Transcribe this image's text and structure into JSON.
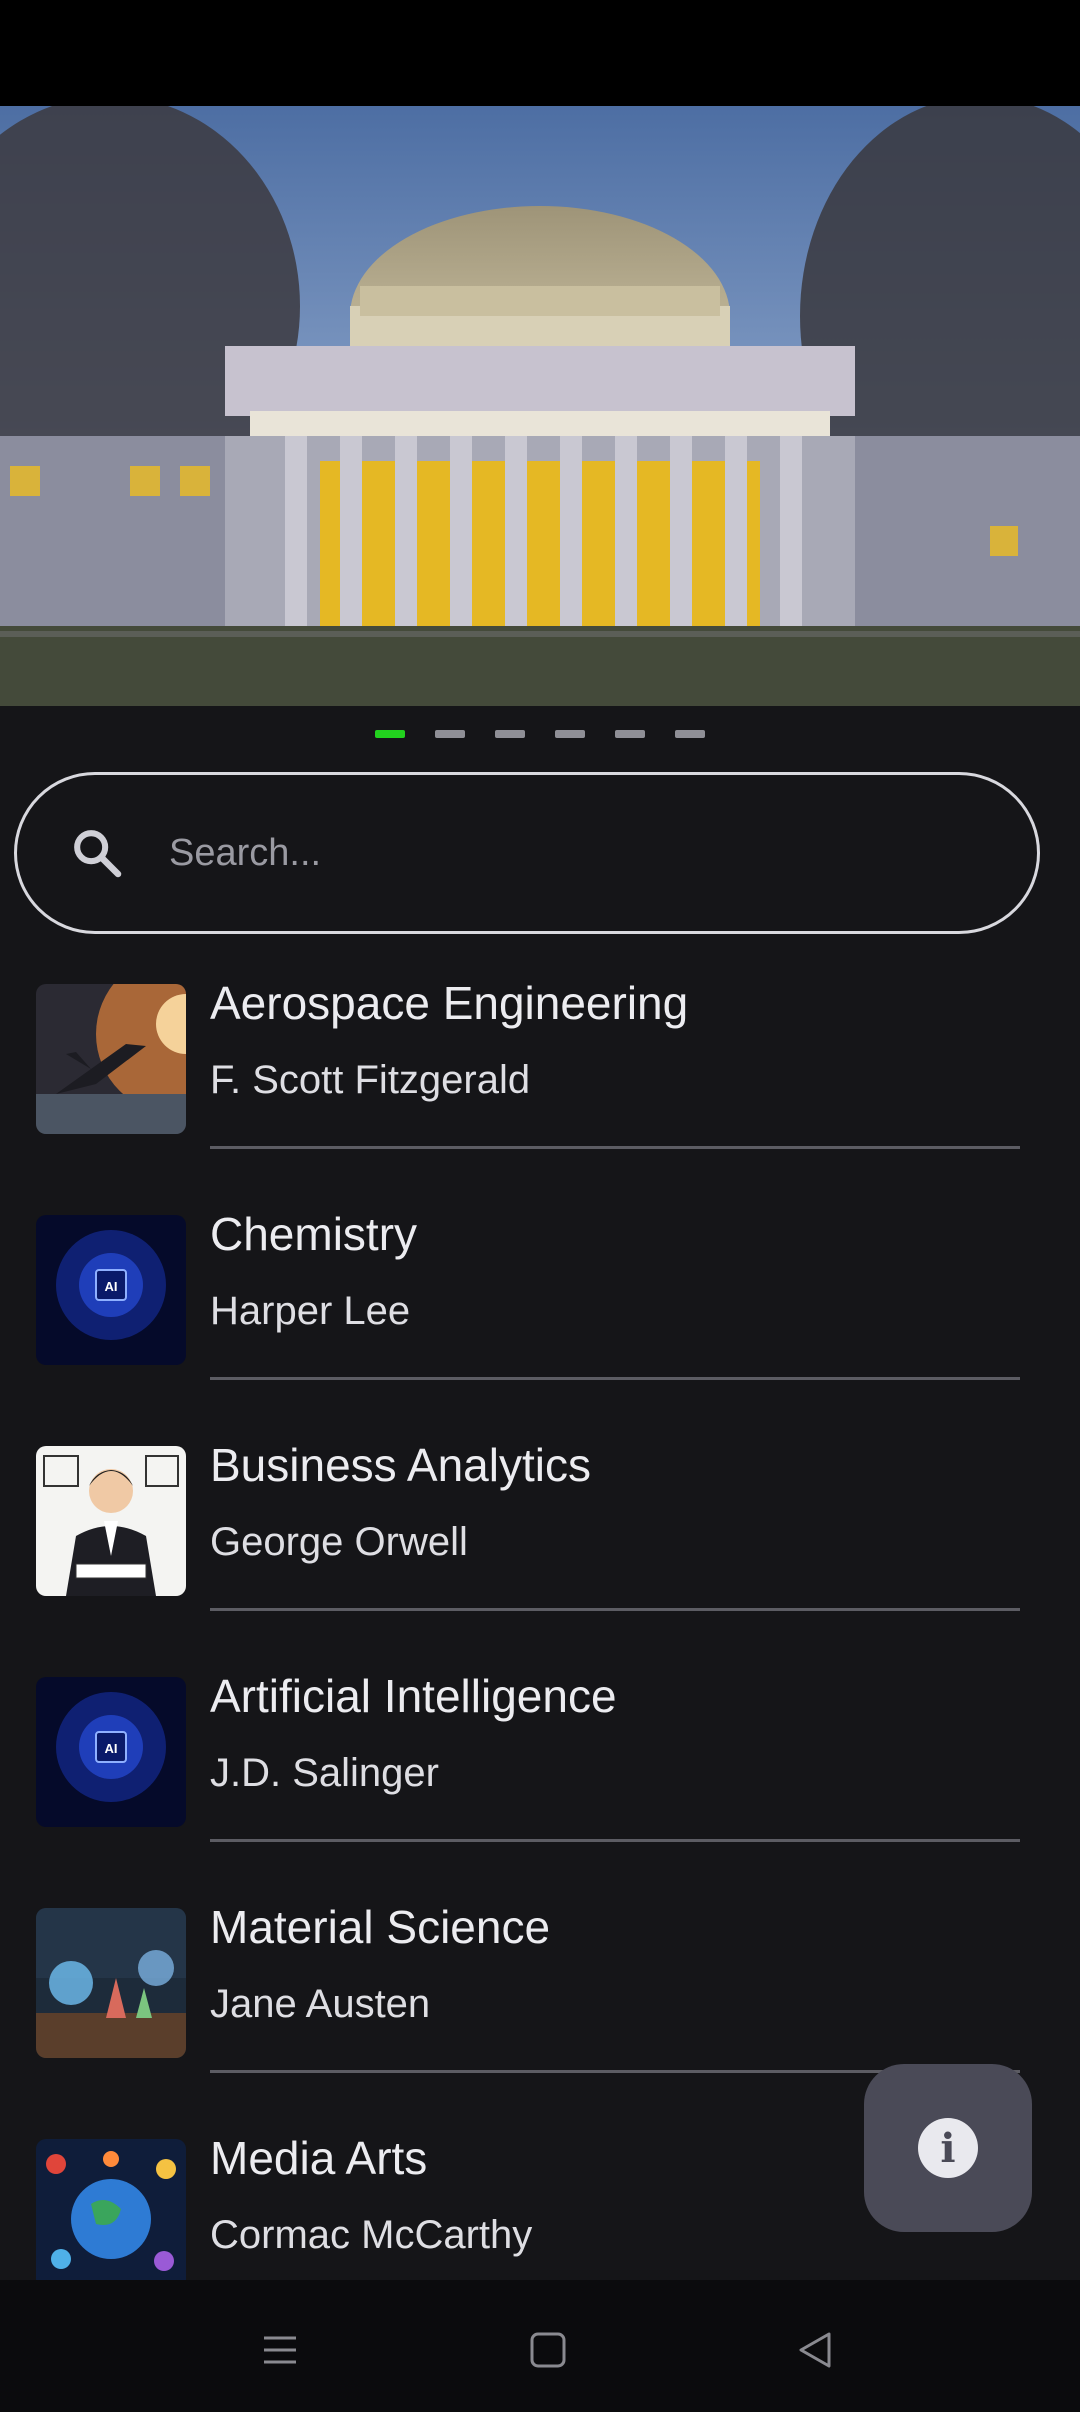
{
  "search": {
    "placeholder": "Search...",
    "value": ""
  },
  "carousel": {
    "page_count": 6,
    "active_index": 0,
    "active_color": "#22d11e",
    "inactive_color": "#8f8f96"
  },
  "courses": [
    {
      "title": "Aerospace Engineering",
      "author": "F. Scott Fitzgerald",
      "thumb": "jet-thumbnail"
    },
    {
      "title": "Chemistry",
      "author": "Harper Lee",
      "thumb": "ai-chip-thumbnail"
    },
    {
      "title": "Business Analytics",
      "author": "George Orwell",
      "thumb": "businessman-thumbnail"
    },
    {
      "title": "Artificial Intelligence",
      "author": "J.D. Salinger",
      "thumb": "ai-chip-thumbnail"
    },
    {
      "title": "Material Science",
      "author": "Jane Austen",
      "thumb": "lab-thumbnail"
    },
    {
      "title": "Media Arts",
      "author": "Cormac McCarthy",
      "thumb": "globe-media-thumbnail"
    }
  ],
  "fab": {
    "icon": "info-icon"
  },
  "nav": {
    "buttons": [
      "menu-icon",
      "home-icon",
      "back-icon"
    ]
  },
  "colors": {
    "background": "#151518",
    "accent": "#22d11e",
    "fab": "#4a4a57"
  }
}
